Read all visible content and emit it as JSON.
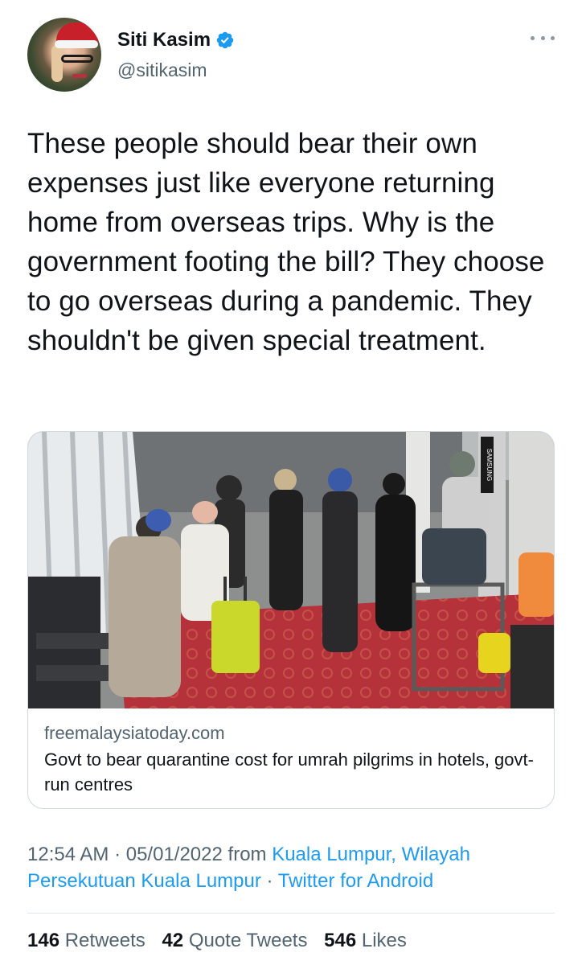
{
  "user": {
    "display_name": "Siti Kasim",
    "handle": "@sitikasim"
  },
  "tweet": {
    "text": "These people should bear their own expenses just like everyone returning home from overseas trips. Why is the government footing the bill? They choose to go overseas during a pandemic. They shouldn't be given special treatment."
  },
  "card": {
    "domain": "freemalaysiatoday.com",
    "title": "Govt to bear quarantine cost for umrah pilgrims in hotels, govt-run centres",
    "image_sign": "SAMSUNG"
  },
  "meta": {
    "time": "12:54 AM",
    "separator": " · ",
    "date": "05/01/2022",
    "from": " from ",
    "location": "Kuala Lumpur, Wilayah Persekutuan Kuala Lumpur",
    "client": "Twitter for Android"
  },
  "stats": {
    "retweets_count": "146",
    "retweets_label": "Retweets",
    "quotes_count": "42",
    "quotes_label": "Quote Tweets",
    "likes_count": "546",
    "likes_label": "Likes"
  },
  "colors": {
    "accent": "#1d9bf0",
    "secondary_text": "#536471",
    "carpet": "#b6323a"
  }
}
